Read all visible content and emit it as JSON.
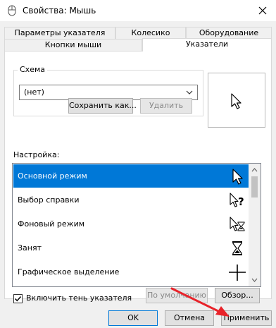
{
  "window": {
    "title": "Свойства: Мышь",
    "app_icon": "mouse-icon",
    "close_icon": "close-icon"
  },
  "tabs": {
    "row1": [
      "Параметры указателя",
      "Колесико",
      "Оборудование"
    ],
    "row2": [
      "Кнопки мыши",
      "Указатели"
    ],
    "active": "Указатели"
  },
  "scheme": {
    "label": "Схема",
    "value": "(нет)",
    "save_as": "Сохранить как...",
    "delete": "Удалить"
  },
  "settings": {
    "label": "Настройка:",
    "items": [
      {
        "label": "Основной режим",
        "icon": "arrow-cursor-icon",
        "selected": true
      },
      {
        "label": "Выбор справки",
        "icon": "help-select-cursor-icon",
        "selected": false
      },
      {
        "label": "Фоновый режим",
        "icon": "working-in-background-cursor-icon",
        "selected": false
      },
      {
        "label": "Занят",
        "icon": "busy-hourglass-cursor-icon",
        "selected": false
      },
      {
        "label": "Графическое выделение",
        "icon": "crosshair-cursor-icon",
        "selected": false
      }
    ]
  },
  "shadow": {
    "label": "Включить тень указателя",
    "checked": true
  },
  "buttons": {
    "default": "По умолчанию",
    "browse": "Обзор...",
    "ok": "OK",
    "cancel": "Отмена",
    "apply": "Применить"
  },
  "colors": {
    "selection": "#0078d7",
    "annotation_arrow": "#e8232a"
  }
}
